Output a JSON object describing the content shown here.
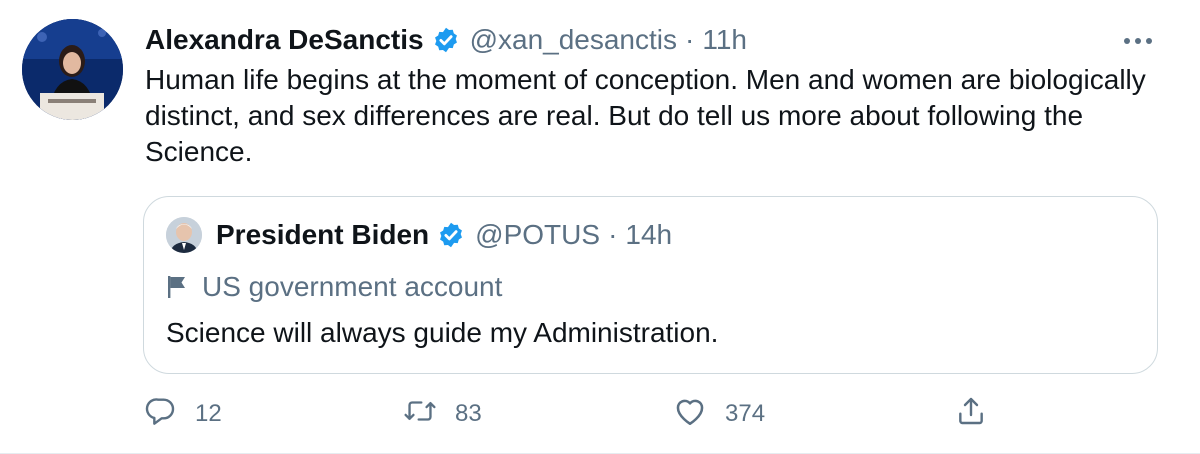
{
  "tweet": {
    "author_name": "Alexandra DeSanctis",
    "author_handle": "@xan_desanctis",
    "separator": "·",
    "time": "11h",
    "text": "Human life begins at the moment of conception. Men and women are biologically distinct, and sex differences are real. But do tell us more about following the Science.",
    "avatar_icon": "profile-photo",
    "verified_icon": "verified-badge-icon",
    "more_icon": "more-dots-icon"
  },
  "quote": {
    "author_name": "President Biden",
    "author_handle": "@POTUS",
    "separator": "·",
    "time": "14h",
    "label": "US government account",
    "label_icon": "flag-icon",
    "text": "Science will always guide my Administration."
  },
  "actions": {
    "reply_count": "12",
    "retweet_count": "83",
    "like_count": "374"
  },
  "colors": {
    "text": "#0f1419",
    "muted": "#5b7083",
    "verified": "#1d9bf0",
    "border": "#cfd9de"
  }
}
